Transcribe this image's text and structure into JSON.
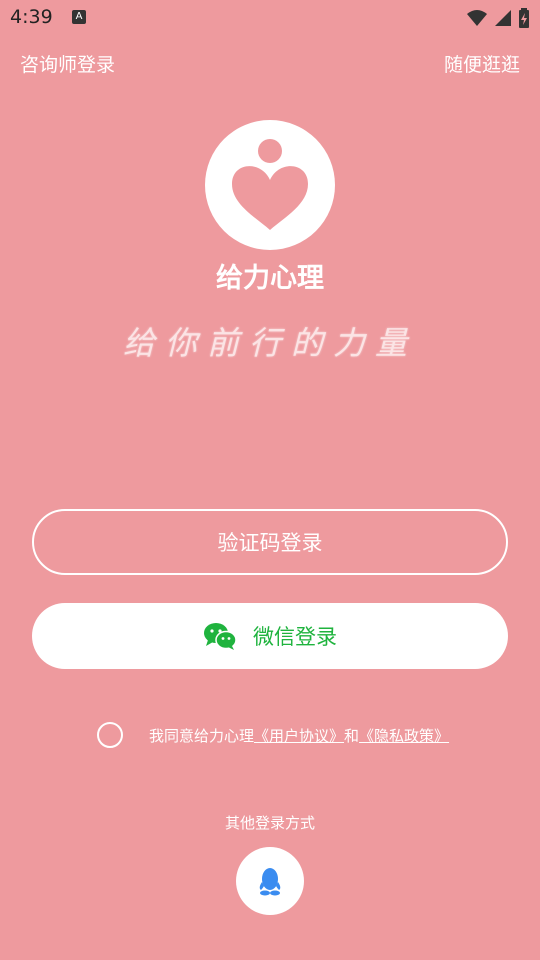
{
  "status_bar": {
    "time": "4:39",
    "notif_glyph": "A"
  },
  "header": {
    "counselor_login": "咨询师登录",
    "browse": "随便逛逛"
  },
  "brand": {
    "app_name": "给力心理",
    "slogan": "给你前行的力量"
  },
  "buttons": {
    "sms_login": "验证码登录",
    "wechat_login": "微信登录"
  },
  "agreement": {
    "prefix": "我同意给力心理",
    "user_agreement": "《用户协议》",
    "conj": "和",
    "privacy_policy": "《隐私政策》"
  },
  "other_login": {
    "label": "其他登录方式",
    "qq_icon": "qq-icon"
  },
  "colors": {
    "background": "#EE9A9E",
    "wechat_green": "#1FB33E",
    "qq_blue": "#3A8CF0"
  }
}
